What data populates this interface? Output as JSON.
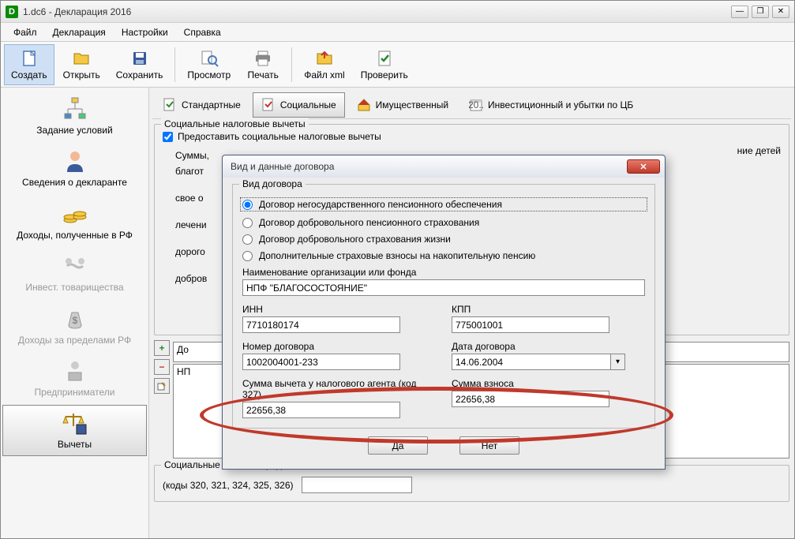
{
  "window": {
    "title": "1.dc6 - Декларация 2016"
  },
  "menu": {
    "file": "Файл",
    "declaration": "Декларация",
    "settings": "Настройки",
    "help": "Справка"
  },
  "toolbar": {
    "create": "Создать",
    "open": "Открыть",
    "save": "Сохранить",
    "preview": "Просмотр",
    "print": "Печать",
    "xml": "Файл xml",
    "check": "Проверить"
  },
  "sidebar": {
    "conditions": "Задание условий",
    "declarant": "Сведения о декларанте",
    "income_rf": "Доходы, полученные в РФ",
    "invest": "Инвест. товарищества",
    "income_abroad": "Доходы за пределами РФ",
    "entrepreneur": "Предприниматели",
    "deductions": "Вычеты"
  },
  "subtabs": {
    "standard": "Стандартные",
    "social": "Социальные",
    "property": "Имущественный",
    "investment": "Инвестиционный и убытки по ЦБ"
  },
  "group1": {
    "title": "Социальные налоговые вычеты",
    "provide": "Предоставить социальные налоговые вычеты",
    "sums": "Суммы,",
    "charity": "благот",
    "own": "свое о",
    "treatment": "лечени",
    "expensive": "дорого",
    "voluntary": "добров",
    "children_end": "ние детей",
    "contracts": "До",
    "npf": "НП"
  },
  "group2": {
    "title": "Социальные вычеты, предоставленные налоговым агентом",
    "codes": "(коды 320, 321, 324, 325, 326)"
  },
  "modal": {
    "title": "Вид и данные договора",
    "fieldset_title": "Вид договора",
    "radio1": "Договор негосударственного пенсионного обеспечения",
    "radio2": "Договор добровольного пенсионного страхования",
    "radio3": "Договор добровольного страхования жизни",
    "radio4": "Дополнительные страховые взносы на накопительную пенсию",
    "org_label": "Наименование организации или фонда",
    "org_value": "НПФ \"БЛАГОСОСТОЯНИЕ\"",
    "inn_label": "ИНН",
    "inn_value": "7710180174",
    "kpp_label": "КПП",
    "kpp_value": "775001001",
    "contract_no_label": "Номер договора",
    "contract_no_value": "1002004001-233",
    "contract_date_label": "Дата договора",
    "contract_date_value": "14.06.2004",
    "deduction_label": "Сумма вычета у налогового агента (код 327)",
    "deduction_value": "22656,38",
    "contribution_label": "Сумма взноса",
    "contribution_value": "22656,38",
    "yes": "Да",
    "no": "Нет"
  }
}
